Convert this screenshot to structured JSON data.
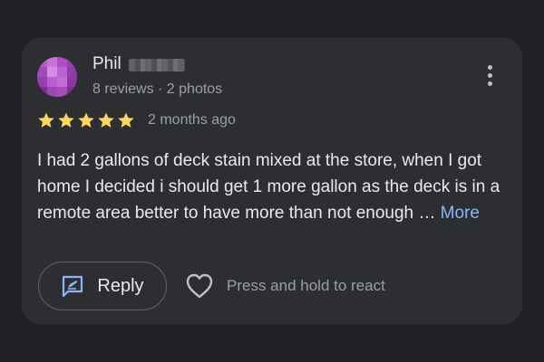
{
  "review": {
    "author_name": "Phil",
    "author_meta": "8 reviews · 2 photos",
    "rating": 5,
    "rating_max": 5,
    "time_ago": "2 months ago",
    "text": "I had 2 gallons of deck stain mixed at the store, when I got home I decided i should get 1 more gallon as the deck is in a remote area better to have more than not enough … ",
    "more_label": "More"
  },
  "actions": {
    "reply_label": "Reply",
    "react_label": "Press and hold to react"
  },
  "icons": {
    "star": "star-icon",
    "more": "more-vertical-icon",
    "reply": "reply-icon",
    "react": "heart-icon"
  },
  "colors": {
    "background": "#202124",
    "card": "#2d2e31",
    "star": "#fdd663",
    "link": "#8ab4f8",
    "reply_icon": "#8ab4f8"
  }
}
